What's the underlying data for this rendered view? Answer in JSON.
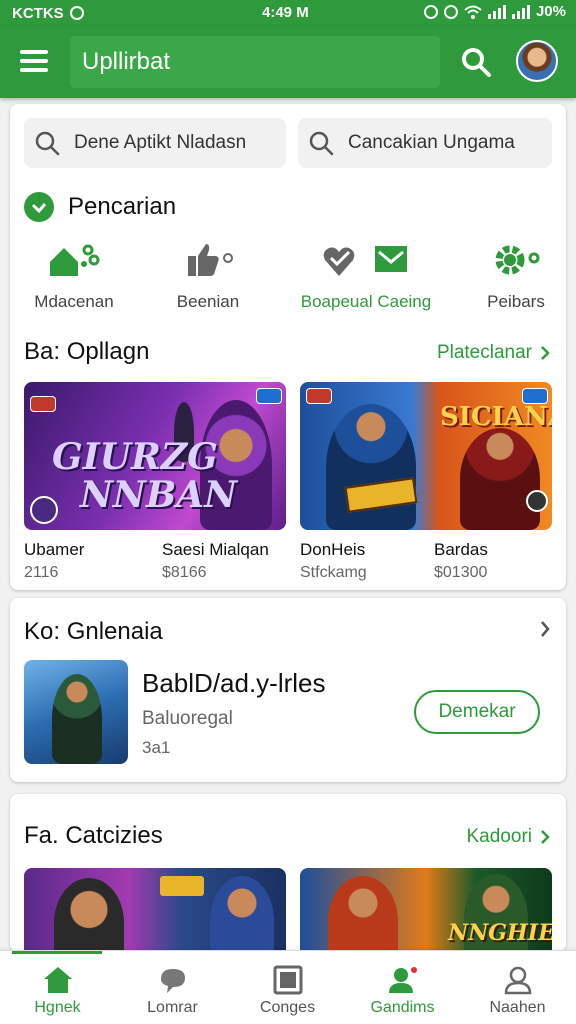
{
  "status_bar": {
    "carrier": "KCTKS",
    "time": "4:49 M",
    "battery": "J0%"
  },
  "app_bar": {
    "title": "Upllirbat",
    "search_icon": "search-icon",
    "avatar_icon": "avatar"
  },
  "search_pills": [
    {
      "label": "Dene Aptikt Nladasn"
    },
    {
      "label": "Cancakian Ungama"
    }
  ],
  "section1": {
    "title": "Pencarian"
  },
  "quick_actions": [
    {
      "label": "Mdacenan",
      "icon": "home-network-icon",
      "highlight": false
    },
    {
      "label": "Beenian",
      "icon": "thumbs-up-icon",
      "highlight": false
    },
    {
      "label": "Boapeual Caeing",
      "icon": "heart-mail-icon",
      "highlight": true
    },
    {
      "label": "Peibars",
      "icon": "gear-icon",
      "highlight": false
    }
  ],
  "row1": {
    "title": "Ba: Opllagn",
    "link": "Plateclanar",
    "banners": [
      {
        "text": "GIURZG NNBAN",
        "text_line1": "GIURZG",
        "text_line2": "NNBAN"
      },
      {
        "text": "SICIANAN"
      }
    ],
    "games": [
      {
        "name": "Ubamer",
        "sub": "2116"
      },
      {
        "name": "Saesi Mialqan",
        "sub": "$8166"
      },
      {
        "name": "DonHeis",
        "sub": "Stfckamg"
      },
      {
        "name": "Bardas",
        "sub": "$01300"
      }
    ]
  },
  "row2": {
    "title": "Ko: Gnlenaia",
    "app": {
      "name": "BablD/ad.y-lrles",
      "developer": "Baluoregal",
      "rating": "3a1",
      "button": "Demekar"
    }
  },
  "row3": {
    "title": "Fa. Catcizies",
    "link": "Kadoori",
    "banner_text": "NNGHIES"
  },
  "bottom_nav": [
    {
      "label": "Hgnek",
      "icon": "home-icon",
      "active": true
    },
    {
      "label": "Lomrar",
      "icon": "chat-icon",
      "active": false
    },
    {
      "label": "Conges",
      "icon": "gallery-icon",
      "active": false
    },
    {
      "label": "Gandims",
      "icon": "person-badge-icon",
      "active": false
    },
    {
      "label": "Naahen",
      "icon": "profile-icon",
      "active": false
    }
  ],
  "colors": {
    "primary": "#2e9a3c",
    "background": "#f1f1f1"
  }
}
